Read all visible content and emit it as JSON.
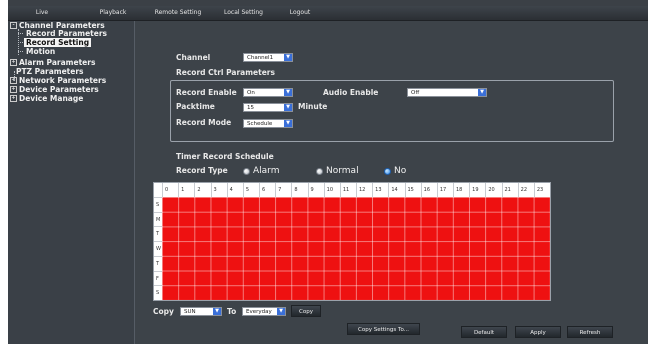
{
  "topnav": {
    "items": [
      {
        "label": "Live"
      },
      {
        "label": "Playback"
      },
      {
        "label": "Remote Setting"
      },
      {
        "label": "Local Setting"
      },
      {
        "label": "Logout"
      }
    ]
  },
  "sidebar": {
    "channel_parameters": "Channel Parameters",
    "record_parameters": "Record Parameters",
    "record_setting": "Record Setting",
    "motion": "Motion",
    "alarm_parameters": "Alarm Parameters",
    "ptz_parameters": "PTZ Parameters",
    "network_parameters": "Network Parameters",
    "device_parameters": "Device Parameters",
    "device_manage": "Device Manage",
    "expand_glyph": "-",
    "collapse_glyph": "+"
  },
  "form": {
    "channel_label": "Channel",
    "channel_value": "Channel1",
    "record_ctrl_title": "Record Ctrl Parameters",
    "record_enable_label": "Record Enable",
    "record_enable_value": "On",
    "audio_enable_label": "Audio Enable",
    "audio_enable_value": "Off",
    "packtime_label": "Packtime",
    "packtime_value": "15",
    "packtime_unit": "Minute",
    "record_mode_label": "Record Mode",
    "record_mode_value": "Schedule",
    "dropdown_arrow": "▼"
  },
  "schedule": {
    "title": "Timer Record Schedule",
    "record_type_label": "Record Type",
    "record_types": [
      "Alarm",
      "Normal",
      "No"
    ],
    "selected_type": "No",
    "hours": [
      "0",
      "1",
      "2",
      "3",
      "4",
      "5",
      "6",
      "7",
      "8",
      "9",
      "10",
      "11",
      "12",
      "13",
      "14",
      "15",
      "16",
      "17",
      "18",
      "19",
      "20",
      "21",
      "22",
      "23"
    ],
    "days": [
      "S",
      "M",
      "T",
      "W",
      "T",
      "F",
      "S"
    ],
    "fill_color": "#ee1111"
  },
  "copy": {
    "copy_label": "Copy",
    "from_value": "SUN",
    "to_label": "To",
    "to_value": "Everyday",
    "copy_button": "Copy"
  },
  "buttons": {
    "copy_settings": "Copy Settings To...",
    "default": "Default",
    "apply": "Apply",
    "refresh": "Refresh"
  }
}
